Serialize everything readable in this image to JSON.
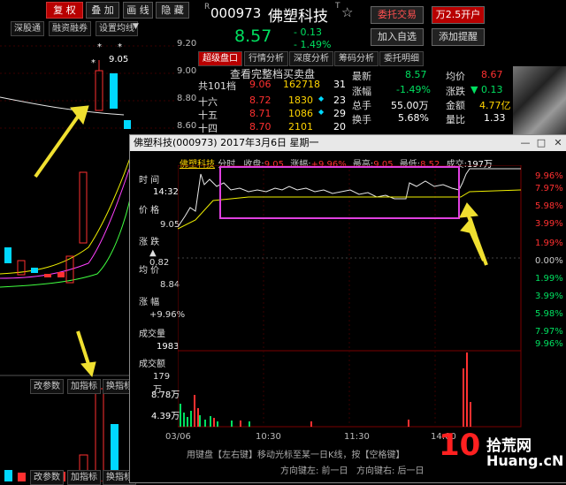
{
  "kline": {
    "toolbar": [
      "复 权",
      "叠 加",
      "画 线",
      "隐 藏"
    ],
    "toolbar_active": 0,
    "sub_toolbar": [
      "深股通",
      "融资融券",
      "设置均线"
    ],
    "price_labels": [
      "9.20",
      "9.00",
      "8.80",
      "8.60"
    ],
    "max_label": "9.05",
    "bottom_toolbar": [
      "改参数",
      "加指标",
      "换指标"
    ],
    "bottom_toolbar2": [
      "改参数",
      "加指标",
      "换指标"
    ]
  },
  "quote": {
    "code": "000973",
    "name": "佛塑科技",
    "price": "8.57",
    "change": "- 0.13",
    "change_pct": "- 1.49%",
    "buttons": [
      "委托交易",
      "万2.5开户",
      "加入自选",
      "添加提醒"
    ],
    "tabs": [
      "超级盘口",
      "行情分析",
      "深度分析",
      "筹码分析",
      "委托明细"
    ],
    "order_header": "查看完整档买卖盘",
    "order_rows": [
      {
        "label": "共101档",
        "price": "9.06",
        "vol": "162718",
        "count": "31"
      },
      {
        "label": "十六",
        "price": "8.72",
        "vol": "1830",
        "count": "23"
      },
      {
        "label": "十五",
        "price": "8.71",
        "vol": "1086",
        "count": "29"
      },
      {
        "label": "十四",
        "price": "8.70",
        "vol": "2101",
        "count": "20"
      }
    ],
    "stats": [
      {
        "k": "最新",
        "v": "8.57",
        "k2": "均价",
        "v2": "8.67"
      },
      {
        "k": "涨幅",
        "v": "-1.49%",
        "k2": "涨跌",
        "v2": "▼ 0.13"
      },
      {
        "k": "总手",
        "v": "55.00万",
        "k2": "金额",
        "v2": "4.77亿"
      },
      {
        "k": "换手",
        "v": "5.68%",
        "k2": "量比",
        "v2": "1.33"
      }
    ]
  },
  "popup": {
    "title": "佛塑科技(000973) 2017年3月6日 星期一",
    "info_name": "佛塑科技",
    "info_type": "分时",
    "info_close_label": "收盘:",
    "info_close": "9.05",
    "info_pct_label": "涨幅:",
    "info_pct": "+9.96%",
    "info_high_label": "最高:",
    "info_high": "9.05",
    "info_low_label": "最低:",
    "info_low": "8.52",
    "info_vol_label": "成交:",
    "info_vol": "197万",
    "left_panel": [
      {
        "k": "时 间",
        "v": "14:32"
      },
      {
        "k": "价 格",
        "v": "9.05"
      },
      {
        "k": "涨 跌",
        "v": "▲ 0.82"
      },
      {
        "k": "均 价",
        "v": "8.84"
      },
      {
        "k": "涨 幅",
        "v": "+9.96%"
      },
      {
        "k": "成交量",
        "v": "1983"
      },
      {
        "k": "成交额",
        "v": "179万"
      }
    ],
    "right_axis": [
      {
        "t": "9.96%",
        "c": "#ff3030"
      },
      {
        "t": "7.97%",
        "c": "#ff3030"
      },
      {
        "t": "5.98%",
        "c": "#ff3030"
      },
      {
        "t": "3.99%",
        "c": "#ff3030"
      },
      {
        "t": "1.99%",
        "c": "#ff3030"
      },
      {
        "t": "0.00%",
        "c": "#cccccc"
      },
      {
        "t": "1.99%",
        "c": "#00e060"
      },
      {
        "t": "3.99%",
        "c": "#00e060"
      },
      {
        "t": "5.98%",
        "c": "#00e060"
      },
      {
        "t": "7.97%",
        "c": "#00e060"
      },
      {
        "t": "9.96%",
        "c": "#00e060"
      }
    ],
    "vol_labels": [
      "8.78万",
      "4.39万"
    ],
    "time_labels": [
      "03/06",
      "10:30",
      "11:30",
      "14:00"
    ],
    "hint1": "用键盘【左右键】移动光标至某一日K线，按【空格键】",
    "hint2": "方向键左: 前一日",
    "hint3": "方向键右: 后一日"
  },
  "watermark": {
    "num": "10",
    "brand": "拾荒网",
    "url": "Huang.cN"
  },
  "colors": {
    "up": "#ff3030",
    "down": "#00e060",
    "accent": "#b80000",
    "highlight": "#e040e0",
    "arrow": "#f0e030"
  }
}
